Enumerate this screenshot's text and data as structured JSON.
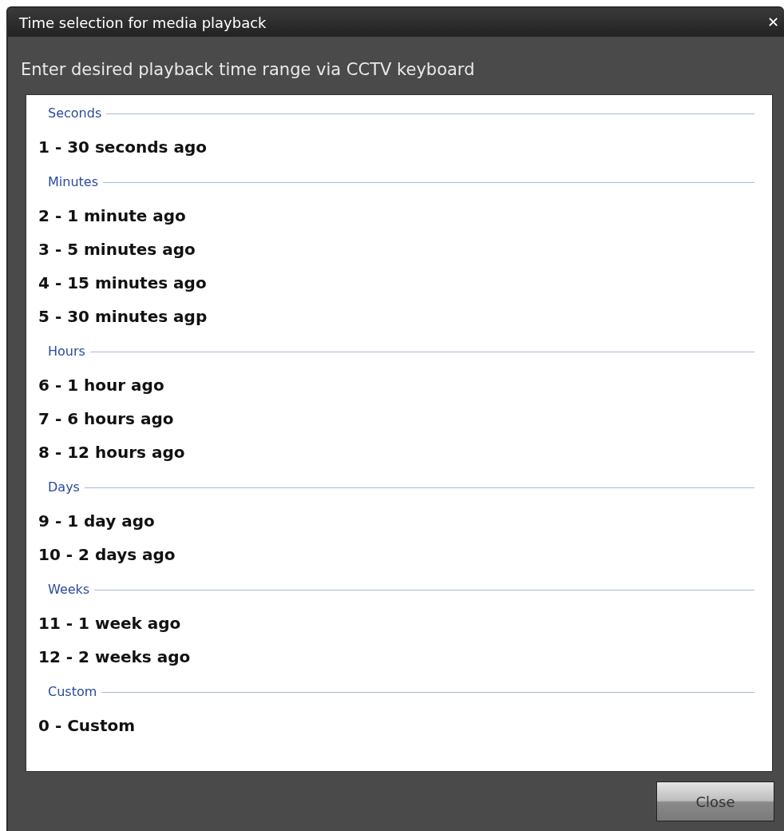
{
  "window": {
    "title": "Time selection for media playback",
    "close_icon": "✕"
  },
  "instruction": "Enter desired playback time range via CCTV keyboard",
  "sections": [
    {
      "heading": "Seconds",
      "options": [
        "1 - 30 seconds ago"
      ]
    },
    {
      "heading": "Minutes",
      "options": [
        "2 - 1 minute ago",
        "3 - 5 minutes ago",
        "4 - 15 minutes ago",
        "5 - 30 minutes agp"
      ]
    },
    {
      "heading": "Hours",
      "options": [
        "6 - 1 hour ago",
        "7 - 6 hours ago",
        "8 - 12 hours ago"
      ]
    },
    {
      "heading": "Days",
      "options": [
        "9 - 1 day ago",
        "10 - 2 days ago"
      ]
    },
    {
      "heading": "Weeks",
      "options": [
        "11 - 1 week ago",
        "12 - 2 weeks ago"
      ]
    },
    {
      "heading": "Custom",
      "options": [
        "0 - Custom"
      ]
    }
  ],
  "buttons": [
    "Close"
  ]
}
